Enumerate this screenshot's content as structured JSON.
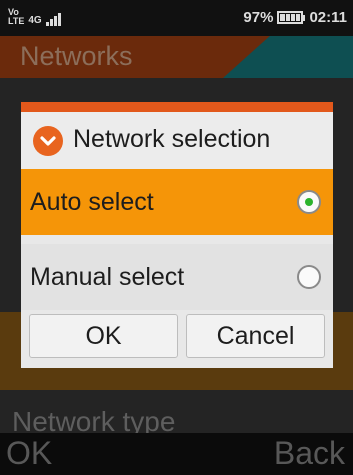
{
  "status_bar": {
    "volte_top": "Vo",
    "volte_bottom": "LTE",
    "network_type": "4G",
    "battery_percent": "97%",
    "battery_level": 0.97,
    "time": "02:11"
  },
  "background": {
    "header_title": "Networks",
    "partial_row_label": "Network type",
    "softkey_left": "OK",
    "softkey_right": "Back"
  },
  "dialog": {
    "title": "Network selection",
    "options": [
      {
        "label": "Auto select",
        "selected": true
      },
      {
        "label": "Manual select",
        "selected": false
      }
    ],
    "ok_label": "OK",
    "cancel_label": "Cancel"
  },
  "colors": {
    "accent": "#e2581b",
    "highlight": "#f59508",
    "radio_selected": "#2bb32b"
  }
}
